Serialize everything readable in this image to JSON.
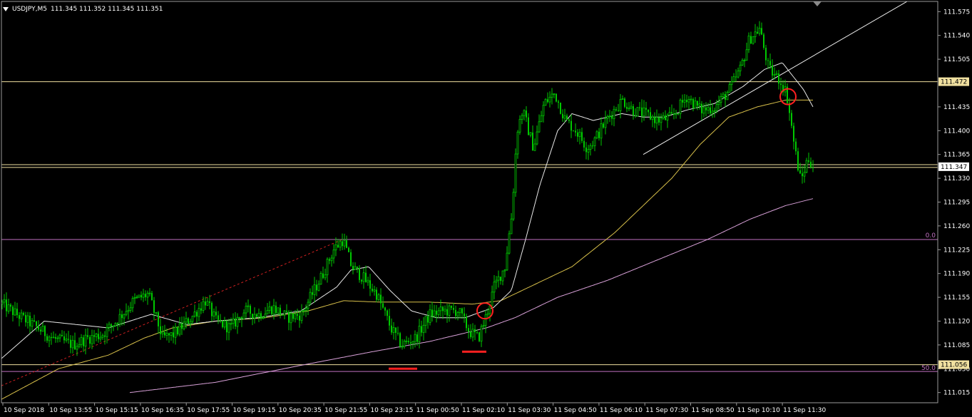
{
  "chart_header": {
    "symbol_tf": "USDJPY,M5",
    "ohlc": "111.345 111.352 111.345 111.351"
  },
  "price_axis": {
    "ticks": [
      "111.575",
      "111.540",
      "111.505",
      "111.435",
      "111.400",
      "111.365",
      "111.330",
      "111.295",
      "111.260",
      "111.225",
      "111.190",
      "111.155",
      "111.120",
      "111.085",
      "111.050",
      "111.015"
    ]
  },
  "time_axis": {
    "ticks": [
      "10 Sep 2018",
      "10 Sep 13:55",
      "10 Sep 15:15",
      "10 Sep 16:35",
      "10 Sep 17:55",
      "10 Sep 19:15",
      "10 Sep 20:35",
      "10 Sep 21:55",
      "10 Sep 23:15",
      "11 Sep 00:50",
      "11 Sep 02:10",
      "11 Sep 03:30",
      "11 Sep 04:50",
      "11 Sep 06:10",
      "11 Sep 07:30",
      "11 Sep 08:50",
      "11 Sep 10:10",
      "11 Sep 11:30"
    ]
  },
  "price_labels": {
    "upper": "111.472",
    "current": "111.347",
    "lower": "111.056"
  },
  "fibo": {
    "top_label": "0.0",
    "bottom_label": "50.0"
  },
  "colors": {
    "background": "#000000",
    "grid_text": "#ffffff",
    "bull": "#00c800",
    "ma_fast": "#e8e8e8",
    "ma_mid": "#d8c04a",
    "ma_slow": "#d8a0d8",
    "hline": "#f0e0a0",
    "fibo": "#c070c0",
    "marker": "#ff2020"
  },
  "chart_data": {
    "type": "candlestick",
    "ylim": [
      111.0,
      111.59
    ],
    "anchor_points": [
      [
        0,
        111.145
      ],
      [
        20,
        111.13
      ],
      [
        50,
        111.11
      ],
      [
        70,
        111.095
      ],
      [
        100,
        111.085
      ],
      [
        120,
        111.095
      ],
      [
        140,
        111.1
      ],
      [
        160,
        111.12
      ],
      [
        185,
        111.15
      ],
      [
        205,
        111.16
      ],
      [
        225,
        111.095
      ],
      [
        240,
        111.1
      ],
      [
        265,
        111.125
      ],
      [
        285,
        111.15
      ],
      [
        300,
        111.12
      ],
      [
        320,
        111.11
      ],
      [
        340,
        111.135
      ],
      [
        360,
        111.13
      ],
      [
        380,
        111.14
      ],
      [
        400,
        111.125
      ],
      [
        420,
        111.13
      ],
      [
        435,
        111.16
      ],
      [
        450,
        111.19
      ],
      [
        465,
        111.225
      ],
      [
        478,
        111.24
      ],
      [
        490,
        111.2
      ],
      [
        505,
        111.185
      ],
      [
        525,
        111.16
      ],
      [
        545,
        111.11
      ],
      [
        560,
        111.085
      ],
      [
        580,
        111.095
      ],
      [
        600,
        111.13
      ],
      [
        620,
        111.135
      ],
      [
        640,
        111.135
      ],
      [
        655,
        111.105
      ],
      [
        668,
        111.095
      ],
      [
        678,
        111.125
      ],
      [
        690,
        111.17
      ],
      [
        705,
        111.2
      ],
      [
        715,
        111.28
      ],
      [
        722,
        111.4
      ],
      [
        730,
        111.43
      ],
      [
        745,
        111.375
      ],
      [
        760,
        111.44
      ],
      [
        775,
        111.455
      ],
      [
        790,
        111.415
      ],
      [
        805,
        111.4
      ],
      [
        820,
        111.375
      ],
      [
        830,
        111.385
      ],
      [
        850,
        111.42
      ],
      [
        870,
        111.445
      ],
      [
        885,
        111.43
      ],
      [
        900,
        111.425
      ],
      [
        920,
        111.415
      ],
      [
        940,
        111.42
      ],
      [
        960,
        111.45
      ],
      [
        980,
        111.43
      ],
      [
        1000,
        111.435
      ],
      [
        1020,
        111.46
      ],
      [
        1035,
        111.49
      ],
      [
        1048,
        111.535
      ],
      [
        1062,
        111.55
      ],
      [
        1075,
        111.49
      ],
      [
        1090,
        111.475
      ],
      [
        1100,
        111.455
      ],
      [
        1105,
        111.42
      ],
      [
        1112,
        111.37
      ],
      [
        1120,
        111.325
      ],
      [
        1130,
        111.36
      ],
      [
        1138,
        111.347
      ]
    ],
    "ma_fast": [
      [
        0,
        111.065
      ],
      [
        60,
        111.12
      ],
      [
        150,
        111.11
      ],
      [
        210,
        111.13
      ],
      [
        260,
        111.115
      ],
      [
        300,
        111.12
      ],
      [
        360,
        111.125
      ],
      [
        420,
        111.135
      ],
      [
        470,
        111.17
      ],
      [
        490,
        111.195
      ],
      [
        515,
        111.2
      ],
      [
        545,
        111.165
      ],
      [
        575,
        111.135
      ],
      [
        610,
        111.125
      ],
      [
        650,
        111.125
      ],
      [
        690,
        111.14
      ],
      [
        715,
        111.165
      ],
      [
        735,
        111.24
      ],
      [
        755,
        111.32
      ],
      [
        780,
        111.4
      ],
      [
        800,
        111.425
      ],
      [
        830,
        111.415
      ],
      [
        870,
        111.425
      ],
      [
        900,
        111.42
      ],
      [
        930,
        111.42
      ],
      [
        960,
        111.43
      ],
      [
        1000,
        111.44
      ],
      [
        1040,
        111.465
      ],
      [
        1070,
        111.49
      ],
      [
        1095,
        111.5
      ],
      [
        1110,
        111.48
      ],
      [
        1125,
        111.46
      ],
      [
        1138,
        111.435
      ]
    ],
    "ma_mid": [
      [
        0,
        111.005
      ],
      [
        80,
        111.05
      ],
      [
        150,
        111.07
      ],
      [
        200,
        111.095
      ],
      [
        240,
        111.11
      ],
      [
        300,
        111.12
      ],
      [
        370,
        111.125
      ],
      [
        430,
        111.135
      ],
      [
        480,
        111.15
      ],
      [
        530,
        111.148
      ],
      [
        600,
        111.148
      ],
      [
        660,
        111.145
      ],
      [
        700,
        111.15
      ],
      [
        740,
        111.17
      ],
      [
        800,
        111.2
      ],
      [
        860,
        111.25
      ],
      [
        900,
        111.29
      ],
      [
        940,
        111.33
      ],
      [
        980,
        111.38
      ],
      [
        1020,
        111.42
      ],
      [
        1060,
        111.435
      ],
      [
        1100,
        111.445
      ],
      [
        1138,
        111.445
      ]
    ],
    "ma_slow": [
      [
        180,
        111.015
      ],
      [
        300,
        111.03
      ],
      [
        420,
        111.055
      ],
      [
        520,
        111.075
      ],
      [
        600,
        111.09
      ],
      [
        680,
        111.11
      ],
      [
        720,
        111.125
      ],
      [
        780,
        111.155
      ],
      [
        850,
        111.18
      ],
      [
        920,
        111.21
      ],
      [
        990,
        111.24
      ],
      [
        1050,
        111.27
      ],
      [
        1100,
        111.29
      ],
      [
        1138,
        111.3
      ]
    ],
    "hlines": [
      111.472,
      111.35,
      111.346
    ],
    "fibo_levels": {
      "0.0": 111.24,
      "50.0": 111.046
    },
    "fibo_base": 111.056,
    "trendline_red": [
      [
        0,
        111.025
      ],
      [
        478,
        111.24
      ]
    ],
    "trendline_white": [
      [
        900,
        111.365
      ],
      [
        1270,
        111.59
      ]
    ],
    "circles": [
      [
        678,
        111.135
      ],
      [
        1103,
        111.45
      ]
    ],
    "support_marks": [
      [
        [
          543,
          111.05
        ],
        [
          583,
          111.05
        ]
      ],
      [
        [
          646,
          111.075
        ],
        [
          680,
          111.075
        ]
      ]
    ]
  }
}
